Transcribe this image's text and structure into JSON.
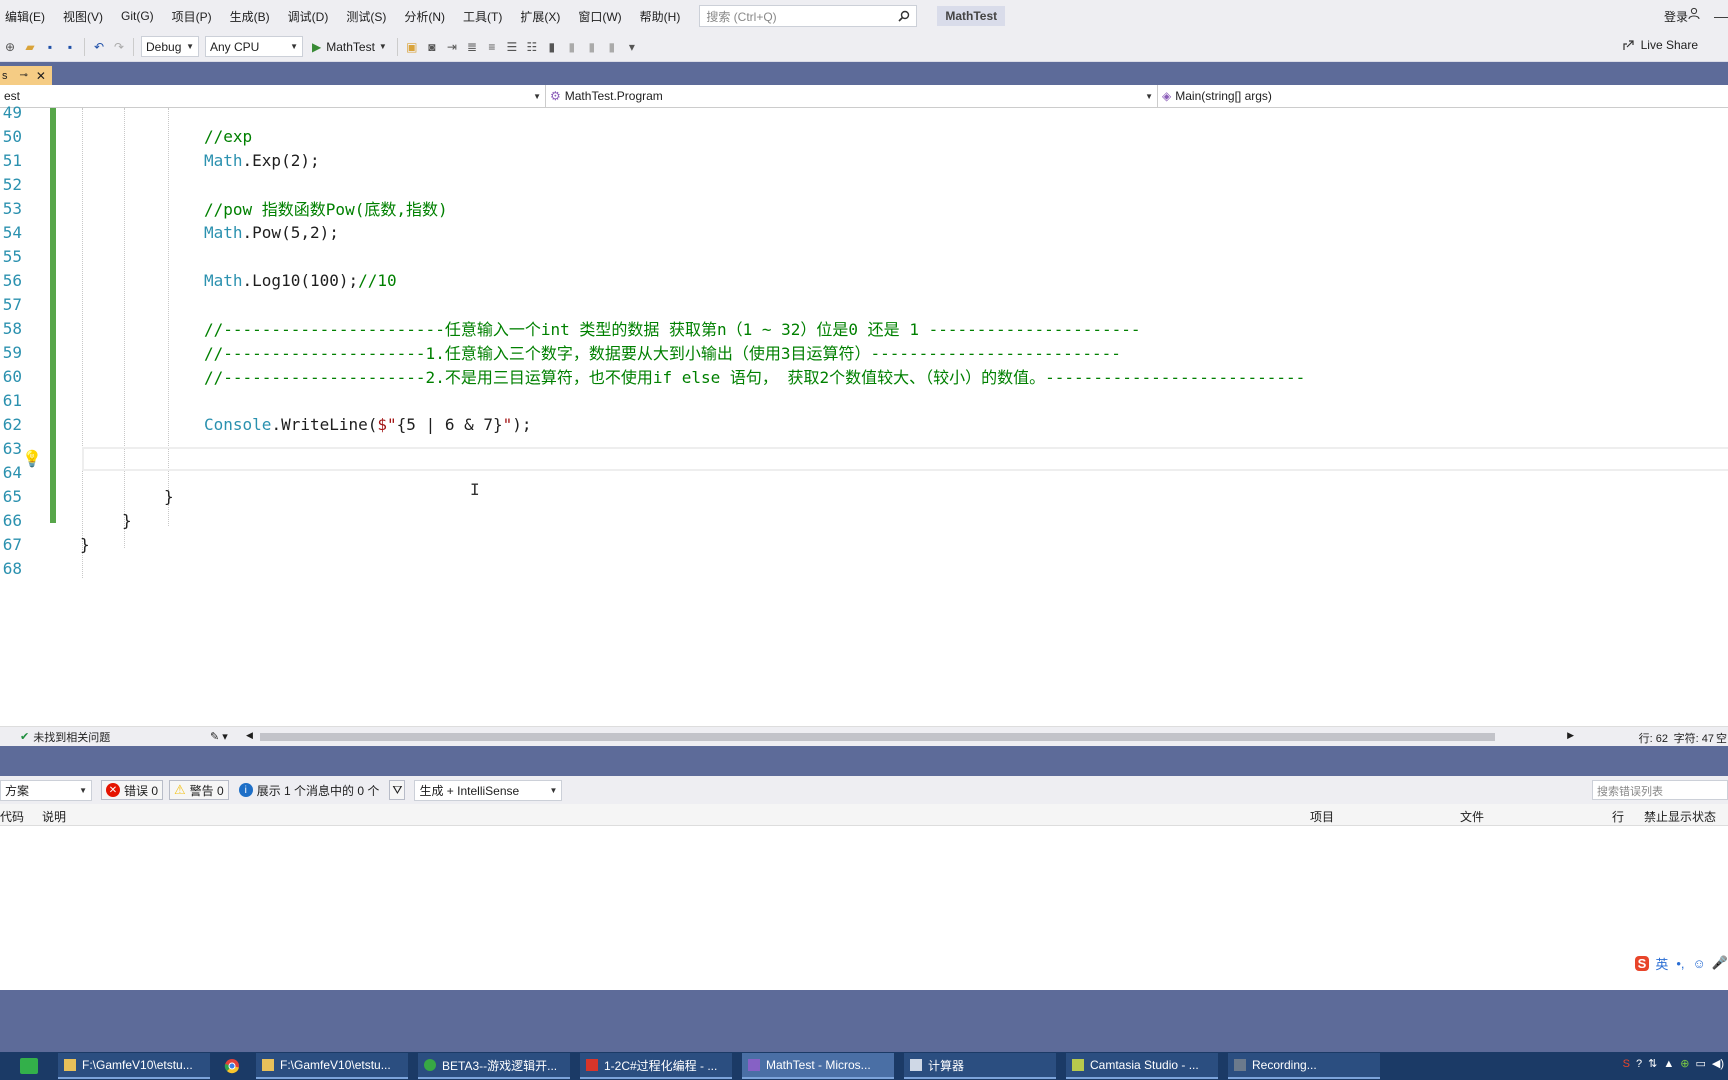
{
  "menu": {
    "items": [
      "编辑(E)",
      "视图(V)",
      "Git(G)",
      "项目(P)",
      "生成(B)",
      "调试(D)",
      "测试(S)",
      "分析(N)",
      "工具(T)",
      "扩展(X)",
      "窗口(W)",
      "帮助(H)"
    ],
    "search_placeholder": "搜索 (Ctrl+Q)",
    "app_title": "MathTest",
    "login": "登录"
  },
  "toolbar": {
    "config": "Debug",
    "platform": "Any CPU",
    "run_label": "MathTest",
    "live_share": "Live Share"
  },
  "tab": {
    "name": "s"
  },
  "navbar": {
    "project": "est",
    "class": "MathTest.Program",
    "member": "Main(string[] args)"
  },
  "editor": {
    "lines": [
      {
        "num": "49",
        "parts": []
      },
      {
        "num": "50",
        "parts": [
          {
            "t": "//exp",
            "c": "comment"
          }
        ]
      },
      {
        "num": "51",
        "parts": [
          {
            "t": "Math",
            "c": "type"
          },
          {
            "t": ".Exp(2);",
            "c": "plain"
          }
        ]
      },
      {
        "num": "52",
        "parts": []
      },
      {
        "num": "53",
        "parts": [
          {
            "t": "//pow 指数函数Pow(底数,指数)",
            "c": "comment"
          }
        ]
      },
      {
        "num": "54",
        "parts": [
          {
            "t": "Math",
            "c": "type"
          },
          {
            "t": ".Pow(5,2);",
            "c": "plain"
          }
        ]
      },
      {
        "num": "55",
        "parts": []
      },
      {
        "num": "56",
        "parts": [
          {
            "t": "Math",
            "c": "type"
          },
          {
            "t": ".Log10(100);",
            "c": "plain"
          },
          {
            "t": "//10",
            "c": "comment"
          }
        ]
      },
      {
        "num": "57",
        "parts": []
      },
      {
        "num": "58",
        "parts": [
          {
            "t": "//-----------------------任意输入一个int 类型的数据 获取第n（1 ~ 32）位是0 还是 1 ----------------------",
            "c": "comment"
          }
        ]
      },
      {
        "num": "59",
        "parts": [
          {
            "t": "//---------------------1.任意输入三个数字，数据要从大到小输出（使用3目运算符）--------------------------",
            "c": "comment"
          }
        ]
      },
      {
        "num": "60",
        "parts": [
          {
            "t": "//---------------------2.不是用三目运算符，也不使用if else 语句， 获取2个数值较大、（较小）的数值。---------------------------",
            "c": "comment"
          }
        ]
      },
      {
        "num": "61",
        "parts": []
      },
      {
        "num": "62",
        "parts": [
          {
            "t": "Console",
            "c": "type"
          },
          {
            "t": ".WriteLine(",
            "c": "plain"
          },
          {
            "t": "$\"",
            "c": "str"
          },
          {
            "t": "{5 | 6 & 7}",
            "c": "plain"
          },
          {
            "t": "\"",
            "c": "str"
          },
          {
            "t": ");",
            "c": "plain"
          }
        ]
      },
      {
        "num": "63",
        "parts": []
      },
      {
        "num": "64",
        "parts": []
      },
      {
        "num": "65",
        "parts": [
          {
            "t": "}",
            "c": "plain"
          }
        ]
      },
      {
        "num": "66",
        "parts": [
          {
            "t": "}",
            "c": "plain"
          }
        ]
      },
      {
        "num": "67",
        "parts": [
          {
            "t": "}",
            "c": "plain"
          }
        ]
      },
      {
        "num": "68",
        "parts": []
      }
    ]
  },
  "editor_status": {
    "issues": "未找到相关问题",
    "row": "行: 62",
    "col": "字符: 47",
    "extra": "空格"
  },
  "errlist": {
    "scope": "方案",
    "errors": "错误 0",
    "warnings": "警告 0",
    "messages": "展示 1 个消息中的 0 个",
    "build_filter": "生成 + IntelliSense",
    "search_placeholder": "搜索错误列表",
    "columns": [
      "代码",
      "说明",
      "项目",
      "文件",
      "行",
      "禁止显示状态"
    ]
  },
  "ime": {
    "lang": "英"
  },
  "taskbar": {
    "items": [
      {
        "label": "F:\\GamfeV10\\etstu...",
        "active": false
      },
      {
        "label": "F:\\GamfeV10\\etstu...",
        "active": false
      },
      {
        "label": "BETA3--游戏逻辑开...",
        "active": false
      },
      {
        "label": "1-2C#过程化编程 - ...",
        "active": false
      },
      {
        "label": "MathTest - Micros...",
        "active": true
      },
      {
        "label": "计算器",
        "active": false
      },
      {
        "label": "Camtasia Studio - ...",
        "active": false
      },
      {
        "label": "Recording...",
        "active": false
      }
    ]
  },
  "colors": {
    "accent": "#5d6b99",
    "comment": "#008000",
    "type": "#2b91af",
    "string": "#a31515",
    "tab_active": "#f5cc84",
    "change_bar": "#57a64a"
  }
}
